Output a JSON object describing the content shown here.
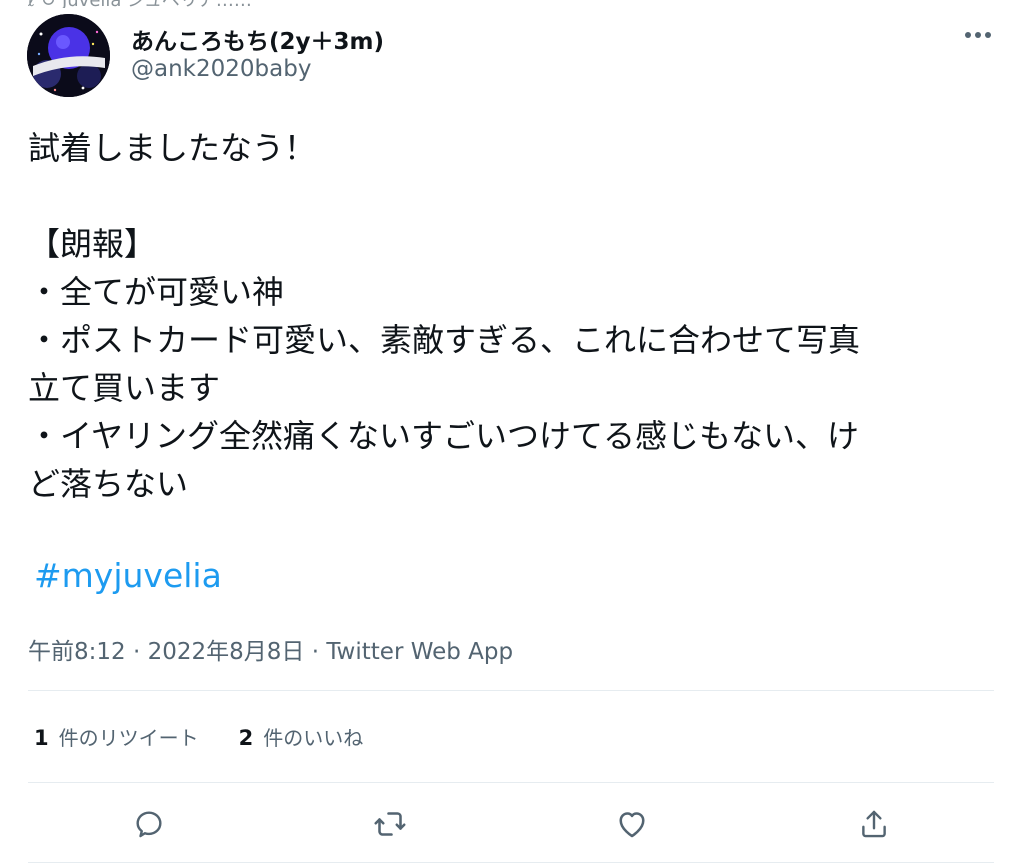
{
  "top_strip": "ℓ ↺ Juvelia ジュベリア……",
  "author": {
    "name": "あんころもち(2y＋3m)",
    "handle": "@ank2020baby"
  },
  "tweet": {
    "lines": [
      "試着しましたなう！",
      "",
      "【朗報】",
      "・全てが可愛い神",
      "・ポストカード可愛い、素敵すぎる、これに合わせて写真",
      "立て買います",
      "・イヤリング全然痛くないすごいつけてる感じもない、け",
      "ど落ちない"
    ],
    "hashtag": "#myjuvelia",
    "meta": "午前8:12 · 2022年8月8日 · Twitter Web App"
  },
  "stats": {
    "retweets_count": "1",
    "retweets_label": "件のリツイート",
    "likes_count": "2",
    "likes_label": "件のいいね"
  },
  "icons": {
    "more": "more-horizontal-icon",
    "reply": "reply-icon",
    "retweet": "retweet-icon",
    "like": "heart-icon",
    "share": "share-icon"
  },
  "colors": {
    "text": "#0f1419",
    "secondary": "#536471",
    "link": "#1d9bf0",
    "divider": "#e6ecf0"
  }
}
